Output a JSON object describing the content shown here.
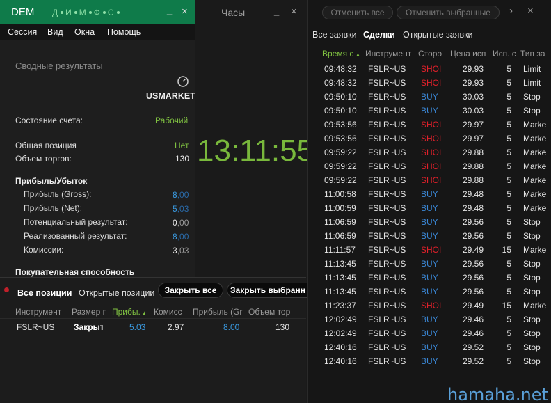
{
  "left_panel": {
    "title": "DEM",
    "tab_letters": [
      "Д",
      "И",
      "М",
      "Ф",
      "С"
    ],
    "controls": {
      "minimize": "_",
      "close": "×"
    },
    "menu": [
      "Сессия",
      "Вид",
      "Окна",
      "Помощь"
    ],
    "summary_link": "Сводные результаты",
    "account_name": "USMARKET",
    "account_state_label": "Состояние счета:",
    "account_state_value": "Рабочий",
    "total_position_label": "Общая позиция",
    "total_position_value": "Нет",
    "volume_label": "Объем торгов:",
    "volume_value": "130",
    "pnl_header": "Прибыль/Убыток",
    "pnl": [
      {
        "label": "Прибыль (Gross):",
        "int": "8",
        "dec": ",00",
        "color": "blue"
      },
      {
        "label": "Прибыль (Net):",
        "int": "5",
        "dec": ",03",
        "color": "blue"
      },
      {
        "label": "Потенциальный результат:",
        "int": "0",
        "dec": ",00",
        "color": "white"
      },
      {
        "label": "Реализованный результат:",
        "int": "8",
        "dec": ",00",
        "color": "blue"
      },
      {
        "label": "Комиссии:",
        "int": "3",
        "dec": ",03",
        "color": "white"
      }
    ],
    "buying_power_header": "Покупательная способность"
  },
  "clock_panel": {
    "title": "Часы",
    "controls": {
      "minimize": "_",
      "close": "×"
    },
    "time": "13:11:55"
  },
  "positions_panel": {
    "tabs": [
      "Все позиции",
      "Открытые позиции"
    ],
    "close_all": "Закрыть все",
    "close_selected": "Закрыть выбранн",
    "columns": [
      "Инструмент",
      "Размер г",
      "Прибы.",
      "Комисс",
      "Прибыль (Gr",
      "Объем тор"
    ],
    "rows": [
      {
        "instrument": "FSLR~US",
        "size": "Закрыт",
        "profit": "5.03",
        "commission": "2.97",
        "gross": "8.00",
        "volume": "130"
      }
    ]
  },
  "orders_panel": {
    "cancel_all": "Отменить все",
    "cancel_selected": "Отменить выбранные",
    "more": "›",
    "close": "×",
    "tabs": [
      "Все заявки",
      "Сделки",
      "Открытые заявки"
    ],
    "active_tab": 1,
    "columns": [
      "Время с",
      "Инструмент",
      "Сторо",
      "Цена исп",
      "Исп. с",
      "Тип за"
    ],
    "trades": [
      {
        "time": "09:48:32",
        "instrument": "FSLR~US",
        "side": "SHOI",
        "price": "29.93",
        "qty": "5",
        "type": "Limit"
      },
      {
        "time": "09:48:32",
        "instrument": "FSLR~US",
        "side": "SHOI",
        "price": "29.93",
        "qty": "5",
        "type": "Limit"
      },
      {
        "time": "09:50:10",
        "instrument": "FSLR~US",
        "side": "BUY",
        "price": "30.03",
        "qty": "5",
        "type": "Stop"
      },
      {
        "time": "09:50:10",
        "instrument": "FSLR~US",
        "side": "BUY",
        "price": "30.03",
        "qty": "5",
        "type": "Stop"
      },
      {
        "time": "09:53:56",
        "instrument": "FSLR~US",
        "side": "SHOI",
        "price": "29.97",
        "qty": "5",
        "type": "Marke"
      },
      {
        "time": "09:53:56",
        "instrument": "FSLR~US",
        "side": "SHOI",
        "price": "29.97",
        "qty": "5",
        "type": "Marke"
      },
      {
        "time": "09:59:22",
        "instrument": "FSLR~US",
        "side": "SHOI",
        "price": "29.88",
        "qty": "5",
        "type": "Marke"
      },
      {
        "time": "09:59:22",
        "instrument": "FSLR~US",
        "side": "SHOI",
        "price": "29.88",
        "qty": "5",
        "type": "Marke"
      },
      {
        "time": "09:59:22",
        "instrument": "FSLR~US",
        "side": "SHOI",
        "price": "29.88",
        "qty": "5",
        "type": "Marke"
      },
      {
        "time": "11:00:58",
        "instrument": "FSLR~US",
        "side": "BUY",
        "price": "29.48",
        "qty": "5",
        "type": "Marke"
      },
      {
        "time": "11:00:59",
        "instrument": "FSLR~US",
        "side": "BUY",
        "price": "29.48",
        "qty": "5",
        "type": "Marke"
      },
      {
        "time": "11:06:59",
        "instrument": "FSLR~US",
        "side": "BUY",
        "price": "29.56",
        "qty": "5",
        "type": "Stop"
      },
      {
        "time": "11:06:59",
        "instrument": "FSLR~US",
        "side": "BUY",
        "price": "29.56",
        "qty": "5",
        "type": "Stop"
      },
      {
        "time": "11:11:57",
        "instrument": "FSLR~US",
        "side": "SHOI",
        "price": "29.49",
        "qty": "15",
        "type": "Marke"
      },
      {
        "time": "11:13:45",
        "instrument": "FSLR~US",
        "side": "BUY",
        "price": "29.56",
        "qty": "5",
        "type": "Stop"
      },
      {
        "time": "11:13:45",
        "instrument": "FSLR~US",
        "side": "BUY",
        "price": "29.56",
        "qty": "5",
        "type": "Stop"
      },
      {
        "time": "11:13:45",
        "instrument": "FSLR~US",
        "side": "BUY",
        "price": "29.56",
        "qty": "5",
        "type": "Stop"
      },
      {
        "time": "11:23:37",
        "instrument": "FSLR~US",
        "side": "SHOI",
        "price": "29.49",
        "qty": "15",
        "type": "Marke"
      },
      {
        "time": "12:02:49",
        "instrument": "FSLR~US",
        "side": "BUY",
        "price": "29.46",
        "qty": "5",
        "type": "Stop"
      },
      {
        "time": "12:02:49",
        "instrument": "FSLR~US",
        "side": "BUY",
        "price": "29.46",
        "qty": "5",
        "type": "Stop"
      },
      {
        "time": "12:40:16",
        "instrument": "FSLR~US",
        "side": "BUY",
        "price": "29.52",
        "qty": "5",
        "type": "Stop"
      },
      {
        "time": "12:40:16",
        "instrument": "FSLR~US",
        "side": "BUY",
        "price": "29.52",
        "qty": "5",
        "type": "Stop"
      }
    ]
  },
  "watermark": "hamaha.net",
  "colors": {
    "title_green": "#0f7b4a",
    "clock_green": "#79b83c",
    "sell_red": "#e0202a",
    "buy_blue": "#3a86d4",
    "accent_blue": "#3a9ae0"
  }
}
